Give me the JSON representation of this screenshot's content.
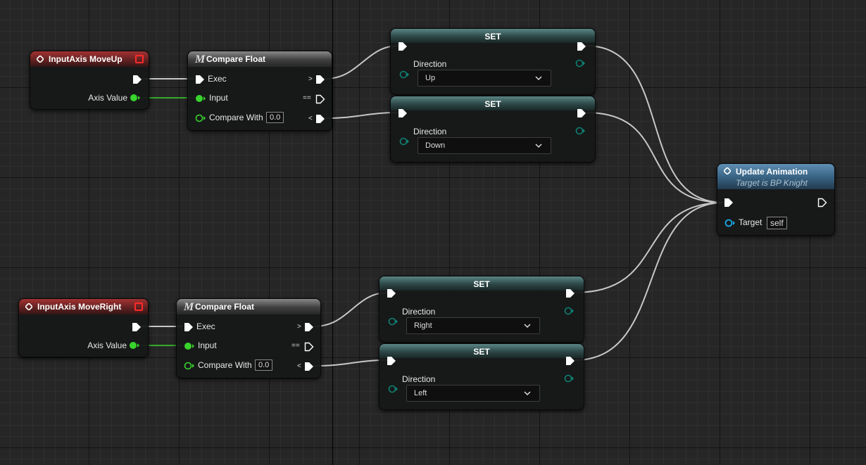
{
  "graph": {
    "up_event": {
      "title": "InputAxis MoveUp",
      "axis_value_label": "Axis Value"
    },
    "up_compare": {
      "title": "Compare Float",
      "exec_label": "Exec",
      "input_label": "Input",
      "compare_with_label": "Compare With",
      "compare_with_value": "0.0",
      "gt_symbol": ">",
      "eq_symbol": "==",
      "lt_symbol": "<"
    },
    "set_up": {
      "title": "SET",
      "var_label": "Direction",
      "value": "Up"
    },
    "set_down": {
      "title": "SET",
      "var_label": "Direction",
      "value": "Down"
    },
    "update_animation": {
      "title": "Update Animation",
      "subtitle": "Target is BP Knight",
      "target_label": "Target",
      "target_value": "self"
    },
    "right_event": {
      "title": "InputAxis MoveRight",
      "axis_value_label": "Axis Value"
    },
    "right_compare": {
      "title": "Compare Float",
      "exec_label": "Exec",
      "input_label": "Input",
      "compare_with_label": "Compare With",
      "compare_with_value": "0.0",
      "gt_symbol": ">",
      "eq_symbol": "==",
      "lt_symbol": "<"
    },
    "set_right": {
      "title": "SET",
      "var_label": "Direction",
      "value": "Right"
    },
    "set_left": {
      "title": "SET",
      "var_label": "Direction",
      "value": "Left"
    }
  },
  "colors": {
    "exec_wire": "#c8c8c8",
    "float_pin": "#38d42c",
    "enum_pin": "#0e7f72",
    "object_pin": "#1aa6e3",
    "event_header": "#a33232",
    "set_header": "#2d4747",
    "call_header": "#3a6585"
  }
}
